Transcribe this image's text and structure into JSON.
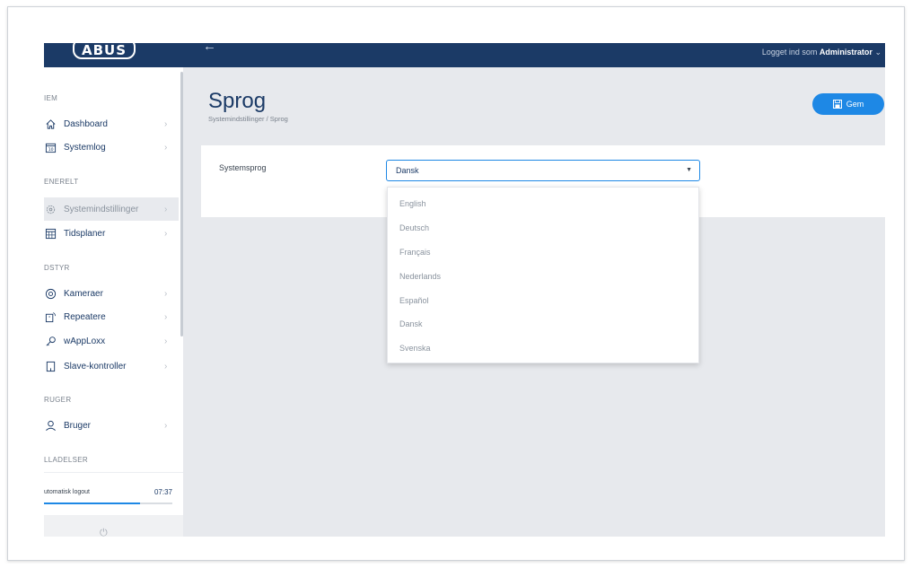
{
  "header": {
    "logo": "ABUS",
    "back_icon": "arrow-left-icon",
    "user_prefix": "Logget ind som ",
    "user_name": "Administrator",
    "user_caret": "⌄"
  },
  "sidebar": {
    "sections": [
      {
        "label": "IEM"
      },
      {
        "label": "ENERELT"
      },
      {
        "label": "DSTYR"
      },
      {
        "label": "RUGER"
      },
      {
        "label": "LLADELSER"
      }
    ],
    "items": [
      {
        "label": "Dashboard",
        "icon": "home-icon"
      },
      {
        "label": "Systemlog",
        "icon": "calendar-icon"
      },
      {
        "label": "Systemindstillinger",
        "icon": "gear-icon",
        "active": true
      },
      {
        "label": "Tidsplaner",
        "icon": "schedule-icon"
      },
      {
        "label": "Kameraer",
        "icon": "camera-icon"
      },
      {
        "label": "Repeatere",
        "icon": "repeater-icon"
      },
      {
        "label": "wAppLoxx",
        "icon": "key-icon"
      },
      {
        "label": "Slave-kontroller",
        "icon": "slave-controller-icon"
      },
      {
        "label": "Bruger",
        "icon": "user-icon"
      }
    ],
    "chevron": "›",
    "logout": {
      "label": "utomatisk logout",
      "time": "07:37",
      "progress": 0.75
    },
    "power_icon": "power-icon"
  },
  "main": {
    "title": "Sprog",
    "breadcrumb": "Systemindstillinger / Sprog",
    "save_label": "Gem",
    "field_label": "Systemsprog",
    "selected": "Dansk",
    "options": [
      "English",
      "Deutsch",
      "Français",
      "Nederlands",
      "Español",
      "Dansk",
      "Svenska"
    ]
  },
  "colors": {
    "navy": "#1b3a66",
    "accent": "#1e88e5",
    "background": "#e7e9ed"
  }
}
